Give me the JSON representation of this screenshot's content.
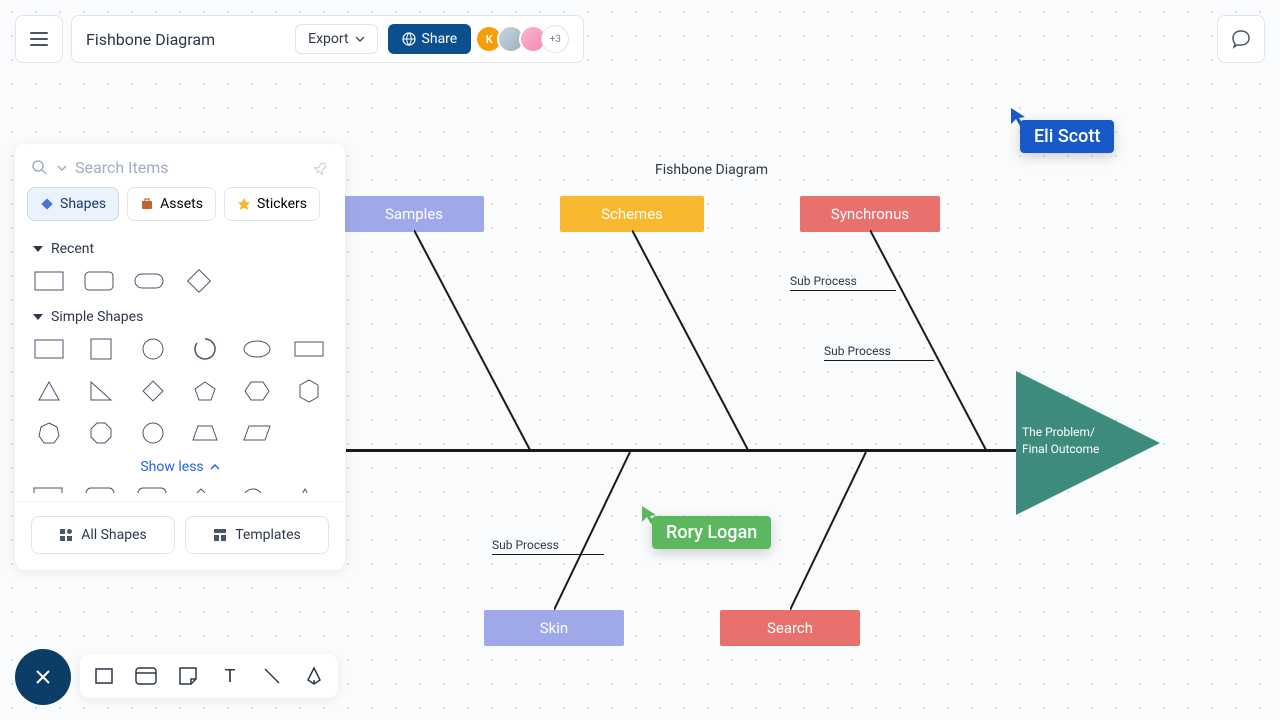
{
  "header": {
    "title": "Fishbone Diagram",
    "export_label": "Export",
    "share_label": "Share",
    "avatar_letter": "K",
    "more_count": "+3"
  },
  "search": {
    "placeholder": "Search Items"
  },
  "tabs": {
    "shapes": "Shapes",
    "assets": "Assets",
    "stickers": "Stickers"
  },
  "sections": {
    "recent": "Recent",
    "simple": "Simple Shapes",
    "show_less": "Show less"
  },
  "footer_buttons": {
    "all_shapes": "All Shapes",
    "templates": "Templates"
  },
  "diagram": {
    "title": "Fishbone Diagram",
    "boxes": {
      "samples": "Samples",
      "schemes": "Schemes",
      "synchronus": "Synchronus",
      "skin": "Skin",
      "search": "Search"
    },
    "sub_process": "Sub Process",
    "outcome_line1": "The Problem/",
    "outcome_line2": "Final Outcome"
  },
  "cursors": {
    "eli": "Eli Scott",
    "rory": "Rory Logan"
  }
}
